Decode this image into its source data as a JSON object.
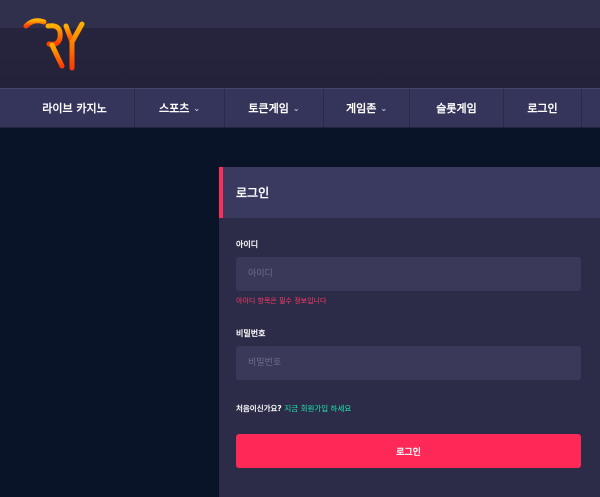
{
  "brand": {
    "logo_text": "TRY",
    "logo_color_top": "#ffb000",
    "logo_color_bottom": "#ff3c00"
  },
  "nav": {
    "items": [
      {
        "label": "라이브 카지노",
        "dropdown": false
      },
      {
        "label": "스포츠",
        "dropdown": true
      },
      {
        "label": "토큰게임",
        "dropdown": true
      },
      {
        "label": "게임존",
        "dropdown": true
      },
      {
        "label": "슬롯게임",
        "dropdown": false
      },
      {
        "label": "로그인",
        "dropdown": false
      }
    ],
    "caret": "⌄"
  },
  "login": {
    "title": "로그인",
    "username_label": "아이디",
    "username_placeholder": "아이디",
    "username_value": "",
    "username_error": "아이디 항목은 필수 정보입니다",
    "password_label": "비밀번호",
    "password_placeholder": "비밀번호",
    "password_value": "",
    "signup_prompt": "처음이신가요?",
    "signup_link": "지금 회원가입 하세요",
    "submit_label": "로그인"
  },
  "colors": {
    "accent": "#ff2957",
    "link": "#1ee8b0",
    "page_bg": "#0a1429",
    "panel_bg": "#2c2b48",
    "nav_bg": "#35345a"
  }
}
